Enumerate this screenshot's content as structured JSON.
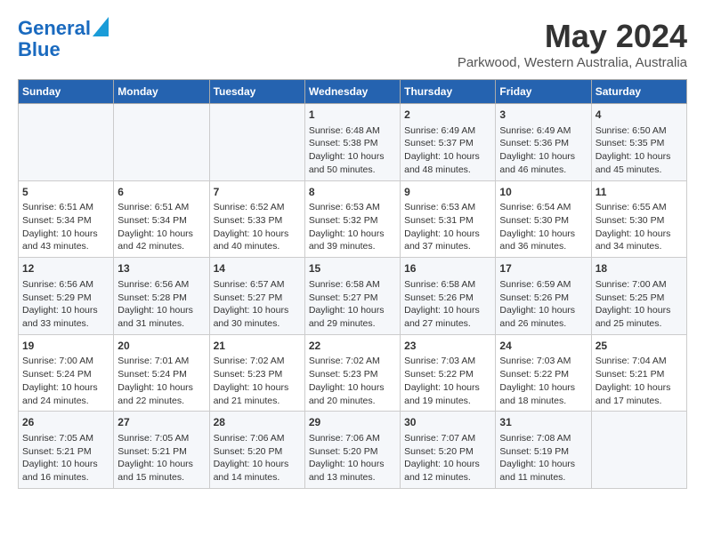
{
  "logo": {
    "line1": "General",
    "line2": "Blue"
  },
  "title": "May 2024",
  "location": "Parkwood, Western Australia, Australia",
  "days_of_week": [
    "Sunday",
    "Monday",
    "Tuesday",
    "Wednesday",
    "Thursday",
    "Friday",
    "Saturday"
  ],
  "weeks": [
    [
      {
        "day": "",
        "info": ""
      },
      {
        "day": "",
        "info": ""
      },
      {
        "day": "",
        "info": ""
      },
      {
        "day": "1",
        "info": "Sunrise: 6:48 AM\nSunset: 5:38 PM\nDaylight: 10 hours\nand 50 minutes."
      },
      {
        "day": "2",
        "info": "Sunrise: 6:49 AM\nSunset: 5:37 PM\nDaylight: 10 hours\nand 48 minutes."
      },
      {
        "day": "3",
        "info": "Sunrise: 6:49 AM\nSunset: 5:36 PM\nDaylight: 10 hours\nand 46 minutes."
      },
      {
        "day": "4",
        "info": "Sunrise: 6:50 AM\nSunset: 5:35 PM\nDaylight: 10 hours\nand 45 minutes."
      }
    ],
    [
      {
        "day": "5",
        "info": "Sunrise: 6:51 AM\nSunset: 5:34 PM\nDaylight: 10 hours\nand 43 minutes."
      },
      {
        "day": "6",
        "info": "Sunrise: 6:51 AM\nSunset: 5:34 PM\nDaylight: 10 hours\nand 42 minutes."
      },
      {
        "day": "7",
        "info": "Sunrise: 6:52 AM\nSunset: 5:33 PM\nDaylight: 10 hours\nand 40 minutes."
      },
      {
        "day": "8",
        "info": "Sunrise: 6:53 AM\nSunset: 5:32 PM\nDaylight: 10 hours\nand 39 minutes."
      },
      {
        "day": "9",
        "info": "Sunrise: 6:53 AM\nSunset: 5:31 PM\nDaylight: 10 hours\nand 37 minutes."
      },
      {
        "day": "10",
        "info": "Sunrise: 6:54 AM\nSunset: 5:30 PM\nDaylight: 10 hours\nand 36 minutes."
      },
      {
        "day": "11",
        "info": "Sunrise: 6:55 AM\nSunset: 5:30 PM\nDaylight: 10 hours\nand 34 minutes."
      }
    ],
    [
      {
        "day": "12",
        "info": "Sunrise: 6:56 AM\nSunset: 5:29 PM\nDaylight: 10 hours\nand 33 minutes."
      },
      {
        "day": "13",
        "info": "Sunrise: 6:56 AM\nSunset: 5:28 PM\nDaylight: 10 hours\nand 31 minutes."
      },
      {
        "day": "14",
        "info": "Sunrise: 6:57 AM\nSunset: 5:27 PM\nDaylight: 10 hours\nand 30 minutes."
      },
      {
        "day": "15",
        "info": "Sunrise: 6:58 AM\nSunset: 5:27 PM\nDaylight: 10 hours\nand 29 minutes."
      },
      {
        "day": "16",
        "info": "Sunrise: 6:58 AM\nSunset: 5:26 PM\nDaylight: 10 hours\nand 27 minutes."
      },
      {
        "day": "17",
        "info": "Sunrise: 6:59 AM\nSunset: 5:26 PM\nDaylight: 10 hours\nand 26 minutes."
      },
      {
        "day": "18",
        "info": "Sunrise: 7:00 AM\nSunset: 5:25 PM\nDaylight: 10 hours\nand 25 minutes."
      }
    ],
    [
      {
        "day": "19",
        "info": "Sunrise: 7:00 AM\nSunset: 5:24 PM\nDaylight: 10 hours\nand 24 minutes."
      },
      {
        "day": "20",
        "info": "Sunrise: 7:01 AM\nSunset: 5:24 PM\nDaylight: 10 hours\nand 22 minutes."
      },
      {
        "day": "21",
        "info": "Sunrise: 7:02 AM\nSunset: 5:23 PM\nDaylight: 10 hours\nand 21 minutes."
      },
      {
        "day": "22",
        "info": "Sunrise: 7:02 AM\nSunset: 5:23 PM\nDaylight: 10 hours\nand 20 minutes."
      },
      {
        "day": "23",
        "info": "Sunrise: 7:03 AM\nSunset: 5:22 PM\nDaylight: 10 hours\nand 19 minutes."
      },
      {
        "day": "24",
        "info": "Sunrise: 7:03 AM\nSunset: 5:22 PM\nDaylight: 10 hours\nand 18 minutes."
      },
      {
        "day": "25",
        "info": "Sunrise: 7:04 AM\nSunset: 5:21 PM\nDaylight: 10 hours\nand 17 minutes."
      }
    ],
    [
      {
        "day": "26",
        "info": "Sunrise: 7:05 AM\nSunset: 5:21 PM\nDaylight: 10 hours\nand 16 minutes."
      },
      {
        "day": "27",
        "info": "Sunrise: 7:05 AM\nSunset: 5:21 PM\nDaylight: 10 hours\nand 15 minutes."
      },
      {
        "day": "28",
        "info": "Sunrise: 7:06 AM\nSunset: 5:20 PM\nDaylight: 10 hours\nand 14 minutes."
      },
      {
        "day": "29",
        "info": "Sunrise: 7:06 AM\nSunset: 5:20 PM\nDaylight: 10 hours\nand 13 minutes."
      },
      {
        "day": "30",
        "info": "Sunrise: 7:07 AM\nSunset: 5:20 PM\nDaylight: 10 hours\nand 12 minutes."
      },
      {
        "day": "31",
        "info": "Sunrise: 7:08 AM\nSunset: 5:19 PM\nDaylight: 10 hours\nand 11 minutes."
      },
      {
        "day": "",
        "info": ""
      }
    ]
  ]
}
